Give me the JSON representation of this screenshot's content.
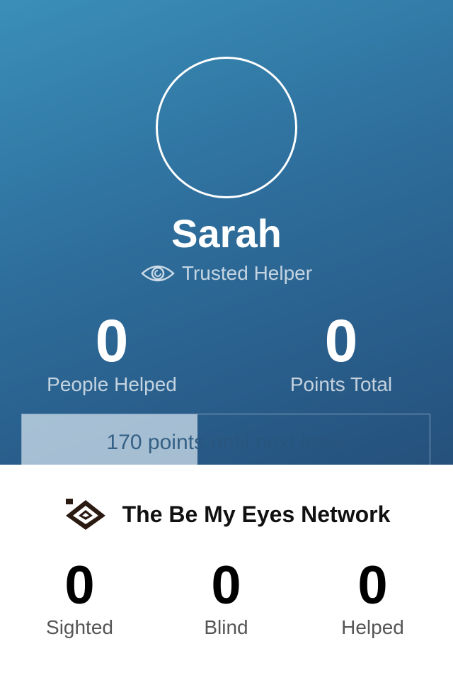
{
  "profile": {
    "name": "Sarah",
    "role": "Trusted Helper",
    "role_icon": "eye-icon",
    "stats": [
      {
        "value": "0",
        "label": "People Helped"
      },
      {
        "value": "0",
        "label": "Points Total"
      }
    ],
    "level": {
      "text": "170 points until next level",
      "progress": 0.43
    }
  },
  "network": {
    "title": "The Be My Eyes Network",
    "logo_icon": "be-my-eyes-logo-icon",
    "stats": [
      {
        "value": "0",
        "label": "Sighted"
      },
      {
        "value": "0",
        "label": "Blind"
      },
      {
        "value": "0",
        "label": "Helped"
      }
    ]
  },
  "colors": {
    "gradient_top": "#3a8fb9",
    "gradient_bottom": "#25507c",
    "text_on_dark": "#ffffff"
  }
}
